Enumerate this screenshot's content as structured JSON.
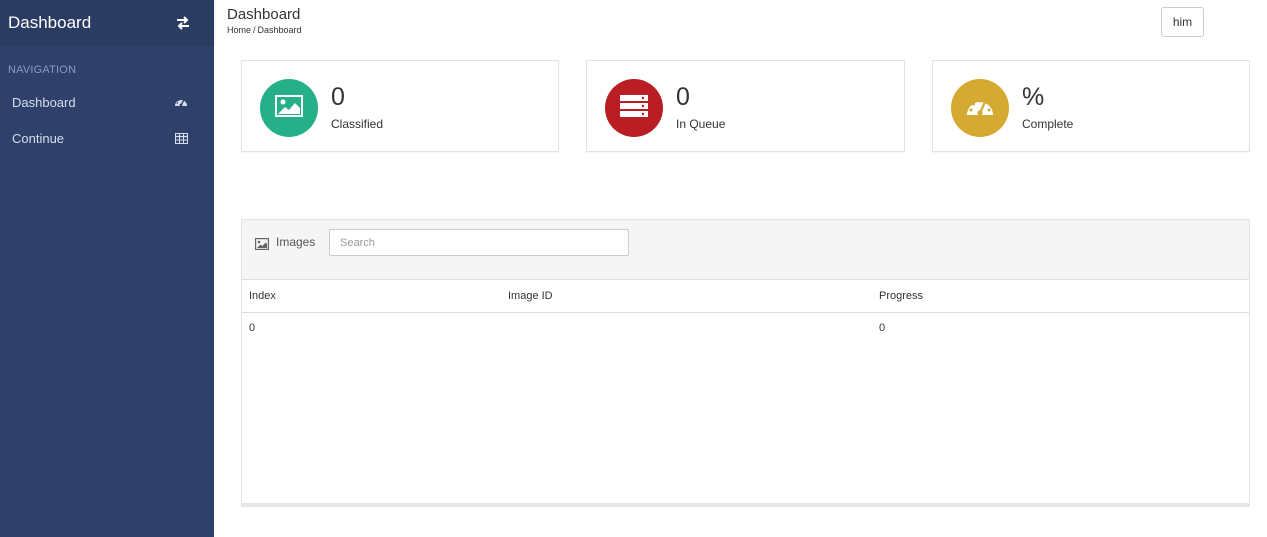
{
  "sidebar": {
    "title": "Dashboard",
    "toggle_icon": "swap-arrows-icon",
    "nav_heading": "NAVIGATION",
    "items": [
      {
        "label": "Dashboard",
        "icon": "dashboard-gauge-icon"
      },
      {
        "label": "Continue",
        "icon": "table-grid-icon"
      }
    ]
  },
  "header": {
    "title": "Dashboard",
    "breadcrumb": [
      "Home",
      "/",
      "Dashboard"
    ],
    "user_button": "him"
  },
  "stats": [
    {
      "value": "0",
      "label": "Classified",
      "icon": "picture-icon",
      "color": "#26b08a"
    },
    {
      "value": "0",
      "label": "In Queue",
      "icon": "server-stack-icon",
      "color": "#b81e23"
    },
    {
      "value": "%",
      "label": "Complete",
      "icon": "speedometer-icon",
      "color": "#d4aa33"
    }
  ],
  "images_panel": {
    "label": "Images",
    "icon": "picture-icon",
    "search_placeholder": "Search",
    "columns": [
      "Index",
      "Image ID",
      "Progress"
    ],
    "rows": [
      [
        "0",
        "",
        "0"
      ]
    ]
  },
  "colors": {
    "sidebar_bg": "#2f416b",
    "sidebar_header_bg": "#2b3c63"
  }
}
